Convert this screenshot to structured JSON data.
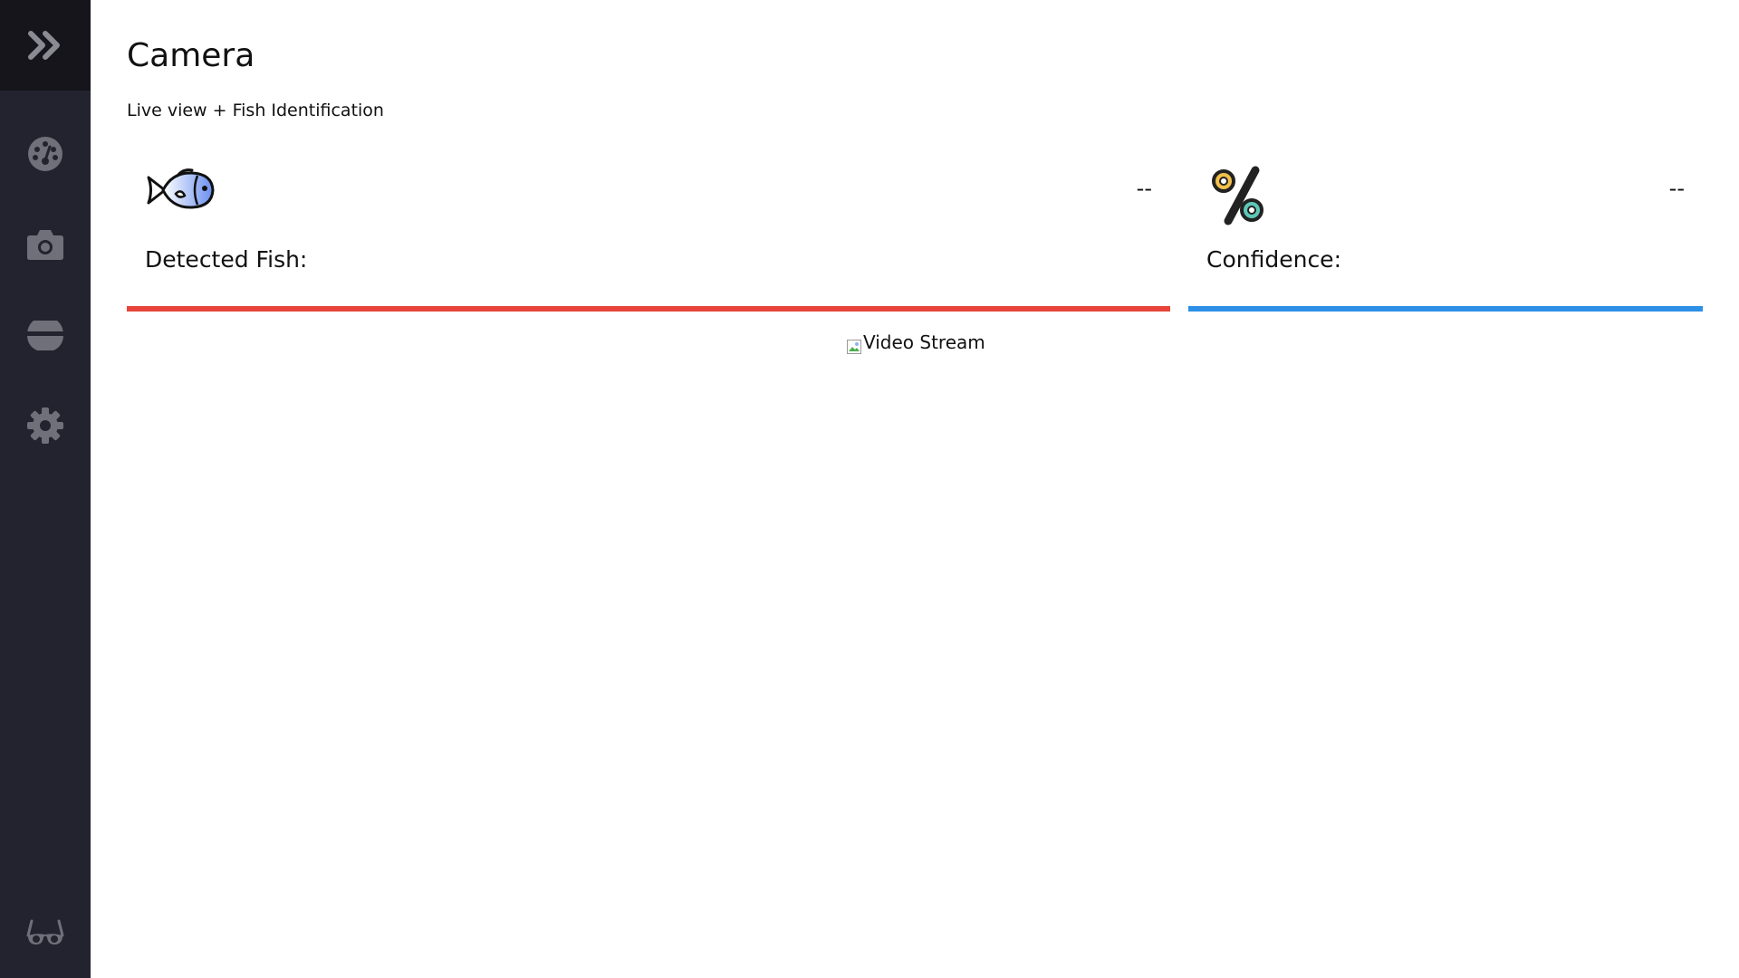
{
  "page": {
    "title": "Camera",
    "subtitle": "Live view + Fish Identification"
  },
  "sidebar": {
    "toggle_icon": "double-chevron-right-icon",
    "items": [
      {
        "icon": "dashboard-gauge-icon"
      },
      {
        "icon": "camera-icon"
      },
      {
        "icon": "fish-bowl-icon"
      },
      {
        "icon": "gear-icon"
      }
    ],
    "bottom_icon": "glasses-icon"
  },
  "cards": {
    "fish": {
      "label": "Detected Fish:",
      "value": "--",
      "icon": "fish-icon",
      "accent": "#e8443a"
    },
    "confidence": {
      "label": "Confidence:",
      "value": "--",
      "icon": "percent-icon",
      "accent": "#2d8fe6"
    }
  },
  "video": {
    "alt": "Video Stream"
  },
  "colors": {
    "sidebar_bg": "#23232f",
    "sidebar_top_bg": "#15151b",
    "sidebar_icon": "#6f7079"
  }
}
